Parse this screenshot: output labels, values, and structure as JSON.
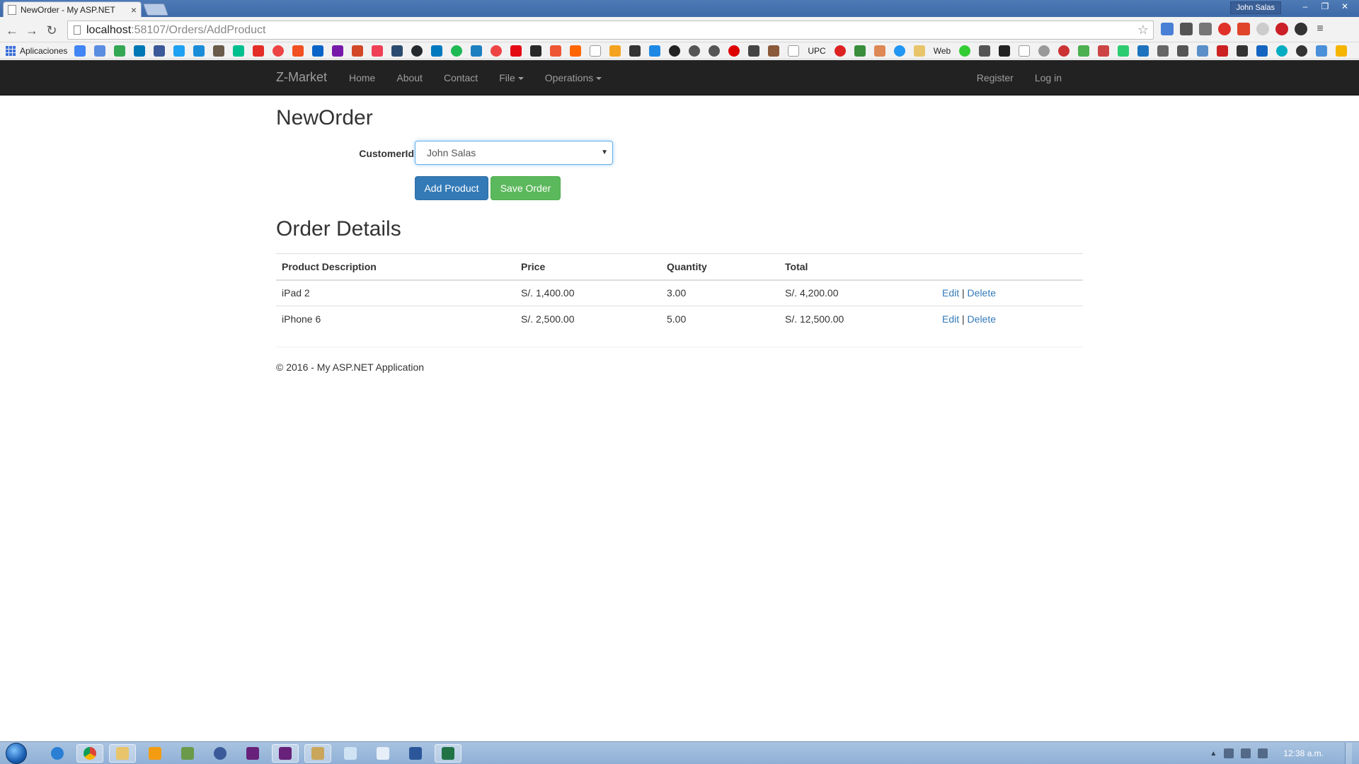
{
  "browser": {
    "tab_title": "NewOrder - My ASP.NET",
    "tab_close": "×",
    "window_user": "John Salas",
    "win_minimize": "–",
    "win_restore": "❐",
    "win_close": "✕",
    "back": "←",
    "forward": "→",
    "reload": "↻",
    "url_host": "localhost",
    "url_rest": ":58107/Orders/AddProduct",
    "star": "☆",
    "bookmarks_apps_label": "Aplicaciones",
    "bookmark_upc": "UPC",
    "bookmark_web": "Web"
  },
  "navbar": {
    "brand": "Z-Market",
    "links": [
      "Home",
      "About",
      "Contact"
    ],
    "file": "File",
    "operations": "Operations",
    "register": "Register",
    "login": "Log in"
  },
  "form": {
    "title": "NewOrder",
    "customer_label": "CustomerId",
    "customer_value": "John Salas",
    "add_product": "Add Product",
    "save_order": "Save Order"
  },
  "details": {
    "title": "Order Details",
    "headers": [
      "Product Description",
      "Price",
      "Quantity",
      "Total"
    ],
    "rows": [
      {
        "description": "iPad 2",
        "price": "S/. 1,400.00",
        "quantity": "3.00",
        "total": "S/. 4,200.00",
        "edit": "Edit",
        "sep": "|",
        "delete": "Delete"
      },
      {
        "description": "iPhone 6",
        "price": "S/. 2,500.00",
        "quantity": "5.00",
        "total": "S/. 12,500.00",
        "edit": "Edit",
        "sep": "|",
        "delete": "Delete"
      }
    ]
  },
  "footer": {
    "text": "© 2016 - My ASP.NET Application"
  },
  "taskbar": {
    "clock": "12:38 a.m."
  }
}
